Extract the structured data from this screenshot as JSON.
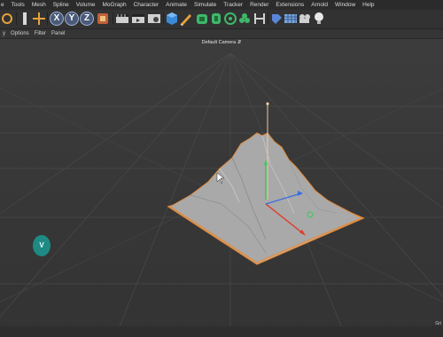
{
  "menu": [
    "e",
    "Tools",
    "Mesh",
    "Spline",
    "Volume",
    "MoGraph",
    "Character",
    "Animate",
    "Simulate",
    "Tracker",
    "Render",
    "Extensions",
    "Arnold",
    "Window",
    "Help"
  ],
  "toolbar": {
    "x_axis": "X",
    "y_axis": "Y",
    "z_axis": "Z"
  },
  "view_menu": [
    "y",
    "Options",
    "Filter",
    "Panel"
  ],
  "viewport": {
    "camera_label": "Default Camera",
    "grid_label": "Gri",
    "badge": "V"
  },
  "colors": {
    "background": "#3a3a3a",
    "selection_outline": "#e08a3c",
    "badge": "#1e8a83",
    "y_axis": "#3cc85a",
    "x_axis": "#e23a2a",
    "z_axis": "#3a6de0"
  }
}
